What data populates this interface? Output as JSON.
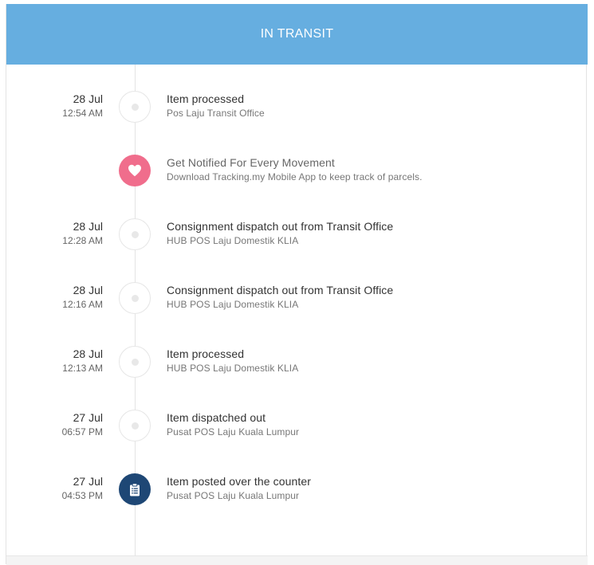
{
  "header": {
    "status": "IN TRANSIT",
    "color": "#66aee0"
  },
  "promo": {
    "title": "Get Notified For Every Movement",
    "subtitle": "Download Tracking.my Mobile App to keep track of parcels.",
    "icon": "heart-icon",
    "color": "#f06d8c"
  },
  "events": [
    {
      "date": "28 Jul",
      "time": "12:54 AM",
      "title": "Item processed",
      "location": "Pos Laju Transit Office"
    },
    {
      "date": "28 Jul",
      "time": "12:28 AM",
      "title": "Consignment dispatch out from Transit Office",
      "location": "HUB POS Laju Domestik KLIA"
    },
    {
      "date": "28 Jul",
      "time": "12:16 AM",
      "title": "Consignment dispatch out from Transit Office",
      "location": "HUB POS Laju Domestik KLIA"
    },
    {
      "date": "28 Jul",
      "time": "12:13 AM",
      "title": "Item processed",
      "location": "HUB POS Laju Domestik KLIA"
    },
    {
      "date": "27 Jul",
      "time": "06:57 PM",
      "title": "Item dispatched out",
      "location": "Pusat POS Laju Kuala Lumpur"
    },
    {
      "date": "27 Jul",
      "time": "04:53 PM",
      "title": "Item posted over the counter",
      "location": "Pusat POS Laju Kuala Lumpur",
      "icon": "clipboard-icon",
      "color": "#1e4775"
    }
  ]
}
